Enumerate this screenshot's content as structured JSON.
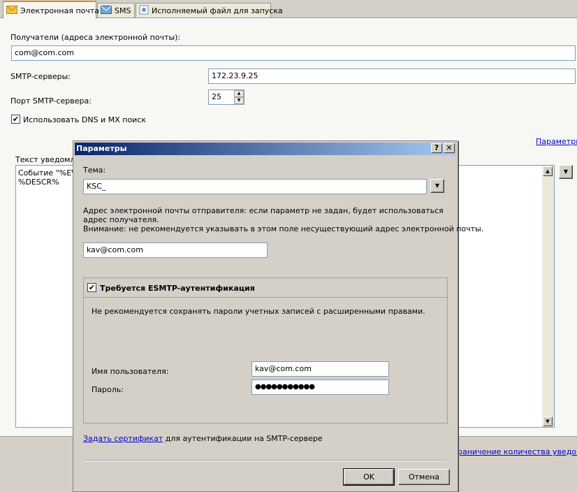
{
  "tabs": [
    {
      "label": "Электронная почта",
      "icon": "envelope-icon",
      "active": true
    },
    {
      "label": "SMS",
      "icon": "sms-icon",
      "active": false
    },
    {
      "label": "Исполняемый файл для запуска",
      "icon": "executable-icon",
      "active": false
    }
  ],
  "email": {
    "recipients_label": "Получатели (адреса электронной почты):",
    "recipients_value": "com@com.com",
    "smtp_servers_label": "SMTP-серверы:",
    "smtp_servers_value": "172.23.9.25",
    "smtp_port_label": "Порт SMTP-сервера:",
    "smtp_port_value": "25",
    "dns_mx_label": "Использовать DNS и MX поиск",
    "dns_mx_checked": true,
    "params_link": "Параметры",
    "notify_text_label": "Текст уведомлен",
    "notify_text_line1": "Событие \"%EVE",
    "notify_text_line2": "%DESCR%",
    "limit_link": "раничение количества уведомлен"
  },
  "dialog": {
    "title": "Параметры",
    "help_label": "?",
    "close_label": "✕",
    "subject_label": "Тема:",
    "subject_value": "KSC_",
    "sender_description": "Адрес электронной почты отправителя: если параметр не задан, будет использоваться адрес получателя.",
    "sender_warning": "Внимание: не рекомендуется указывать в этом поле несуществующий адрес электронной почты.",
    "sender_value": "kav@com.com",
    "esmtp_label": "Требуется ESMTP-аутентификация",
    "esmtp_checked": true,
    "esmtp_note": "Не рекомендуется сохранять пароли учетных записей с расширенными правами.",
    "username_label": "Имя пользователя:",
    "username_value": "kav@com.com",
    "password_label": "Пароль:",
    "password_value": "●●●●●●●●●●●",
    "cert_link": "Задать сертификат",
    "cert_text": " для аутентификации на SMTP-сервере",
    "ok_label": "OK",
    "cancel_label": "Отмена"
  },
  "colors": {
    "accent": "#0a246a",
    "link": "#0000cc",
    "tab_highlight": "#e68b2c"
  }
}
